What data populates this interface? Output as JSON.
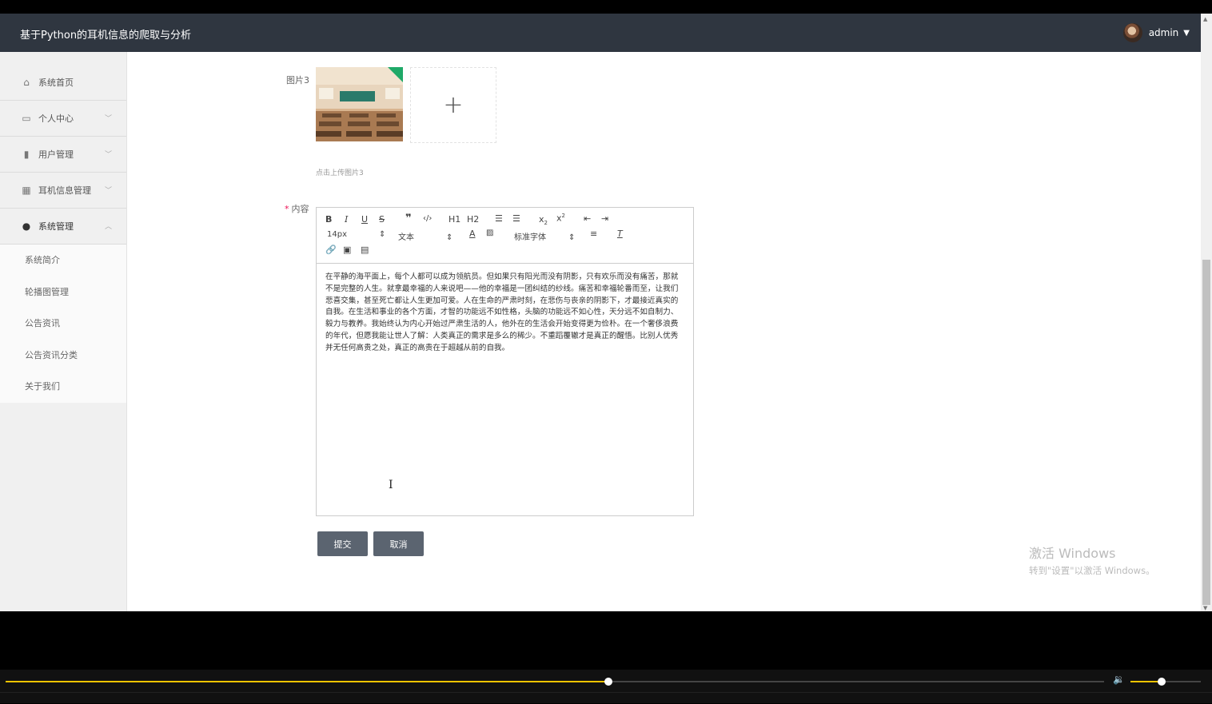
{
  "header": {
    "title": "基于Python的耳机信息的爬取与分析",
    "username": "admin"
  },
  "sidebar": {
    "items": [
      {
        "label": "系统首页",
        "icon": "home-icon"
      },
      {
        "label": "个人中心",
        "icon": "card-icon"
      },
      {
        "label": "用户管理",
        "icon": "chart-icon"
      },
      {
        "label": "耳机信息管理",
        "icon": "grid-icon"
      },
      {
        "label": "系统管理",
        "icon": "user-icon"
      }
    ],
    "subitems": [
      "系统简介",
      "轮播图管理",
      "公告资讯",
      "公告资讯分类",
      "关于我们"
    ]
  },
  "form": {
    "image3_label": "图片3",
    "image3_hint": "点击上传图片3",
    "content_label": "内容",
    "required_mark": "*",
    "content_text": "在平静的海平面上，每个人都可以成为领航员。但如果只有阳光而没有阴影，只有欢乐而没有痛苦，那就不是完整的人生。就拿最幸福的人来说吧——他的幸福是一团纠结的纱线。痛苦和幸福轮番而至，让我们悲喜交集，甚至死亡都让人生更加可爱。人在生命的严肃时刻，在悲伤与丧亲的阴影下，才最接近真实的自我。在生活和事业的各个方面，才智的功能远不如性格，头脑的功能远不如心性，天分远不如自制力、毅力与教养。我始终认为内心开始过严肃生活的人，他外在的生活会开始变得更为俭朴。在一个奢侈浪费的年代，但愿我能让世人了解：人类真正的需求是多么的稀少。不重蹈覆辙才是真正的醒悟。比别人优秀并无任何高贵之处，真正的高贵在于超越从前的自我。",
    "editor": {
      "font_size": "14px",
      "header_select": "文本",
      "font_family": "标准字体",
      "h1": "H1",
      "h2": "H2"
    },
    "submit_label": "提交",
    "cancel_label": "取消"
  },
  "watermark": {
    "line1": "激活 Windows",
    "line2": "转到\"设置\"以激活 Windows。"
  },
  "player": {
    "progress": 0.549,
    "volume": 0.44
  }
}
